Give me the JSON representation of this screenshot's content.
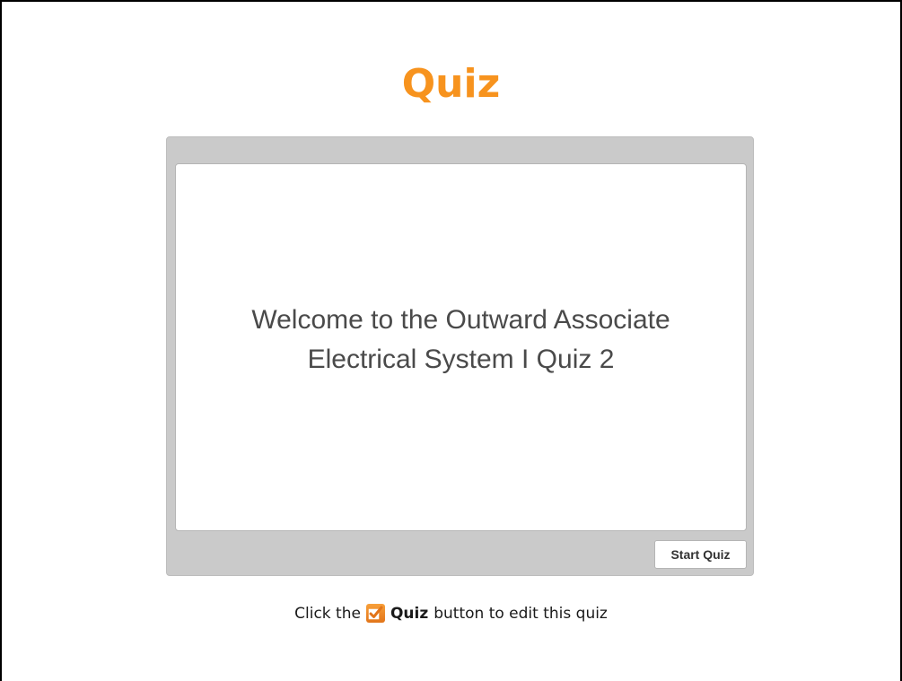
{
  "title": "Quiz",
  "welcome": {
    "line1": "Welcome to the Outward Associate",
    "line2": "Electrical System I Quiz 2"
  },
  "start_button_label": "Start Quiz",
  "hint": {
    "prefix": "Click the",
    "button_name": "Quiz",
    "suffix": "button to edit this quiz"
  },
  "icons": {
    "quiz_checkbox": "checkbox-icon"
  },
  "colors": {
    "title": "#f7931e",
    "panel": "#cacaca",
    "icon": "#f08a24"
  }
}
